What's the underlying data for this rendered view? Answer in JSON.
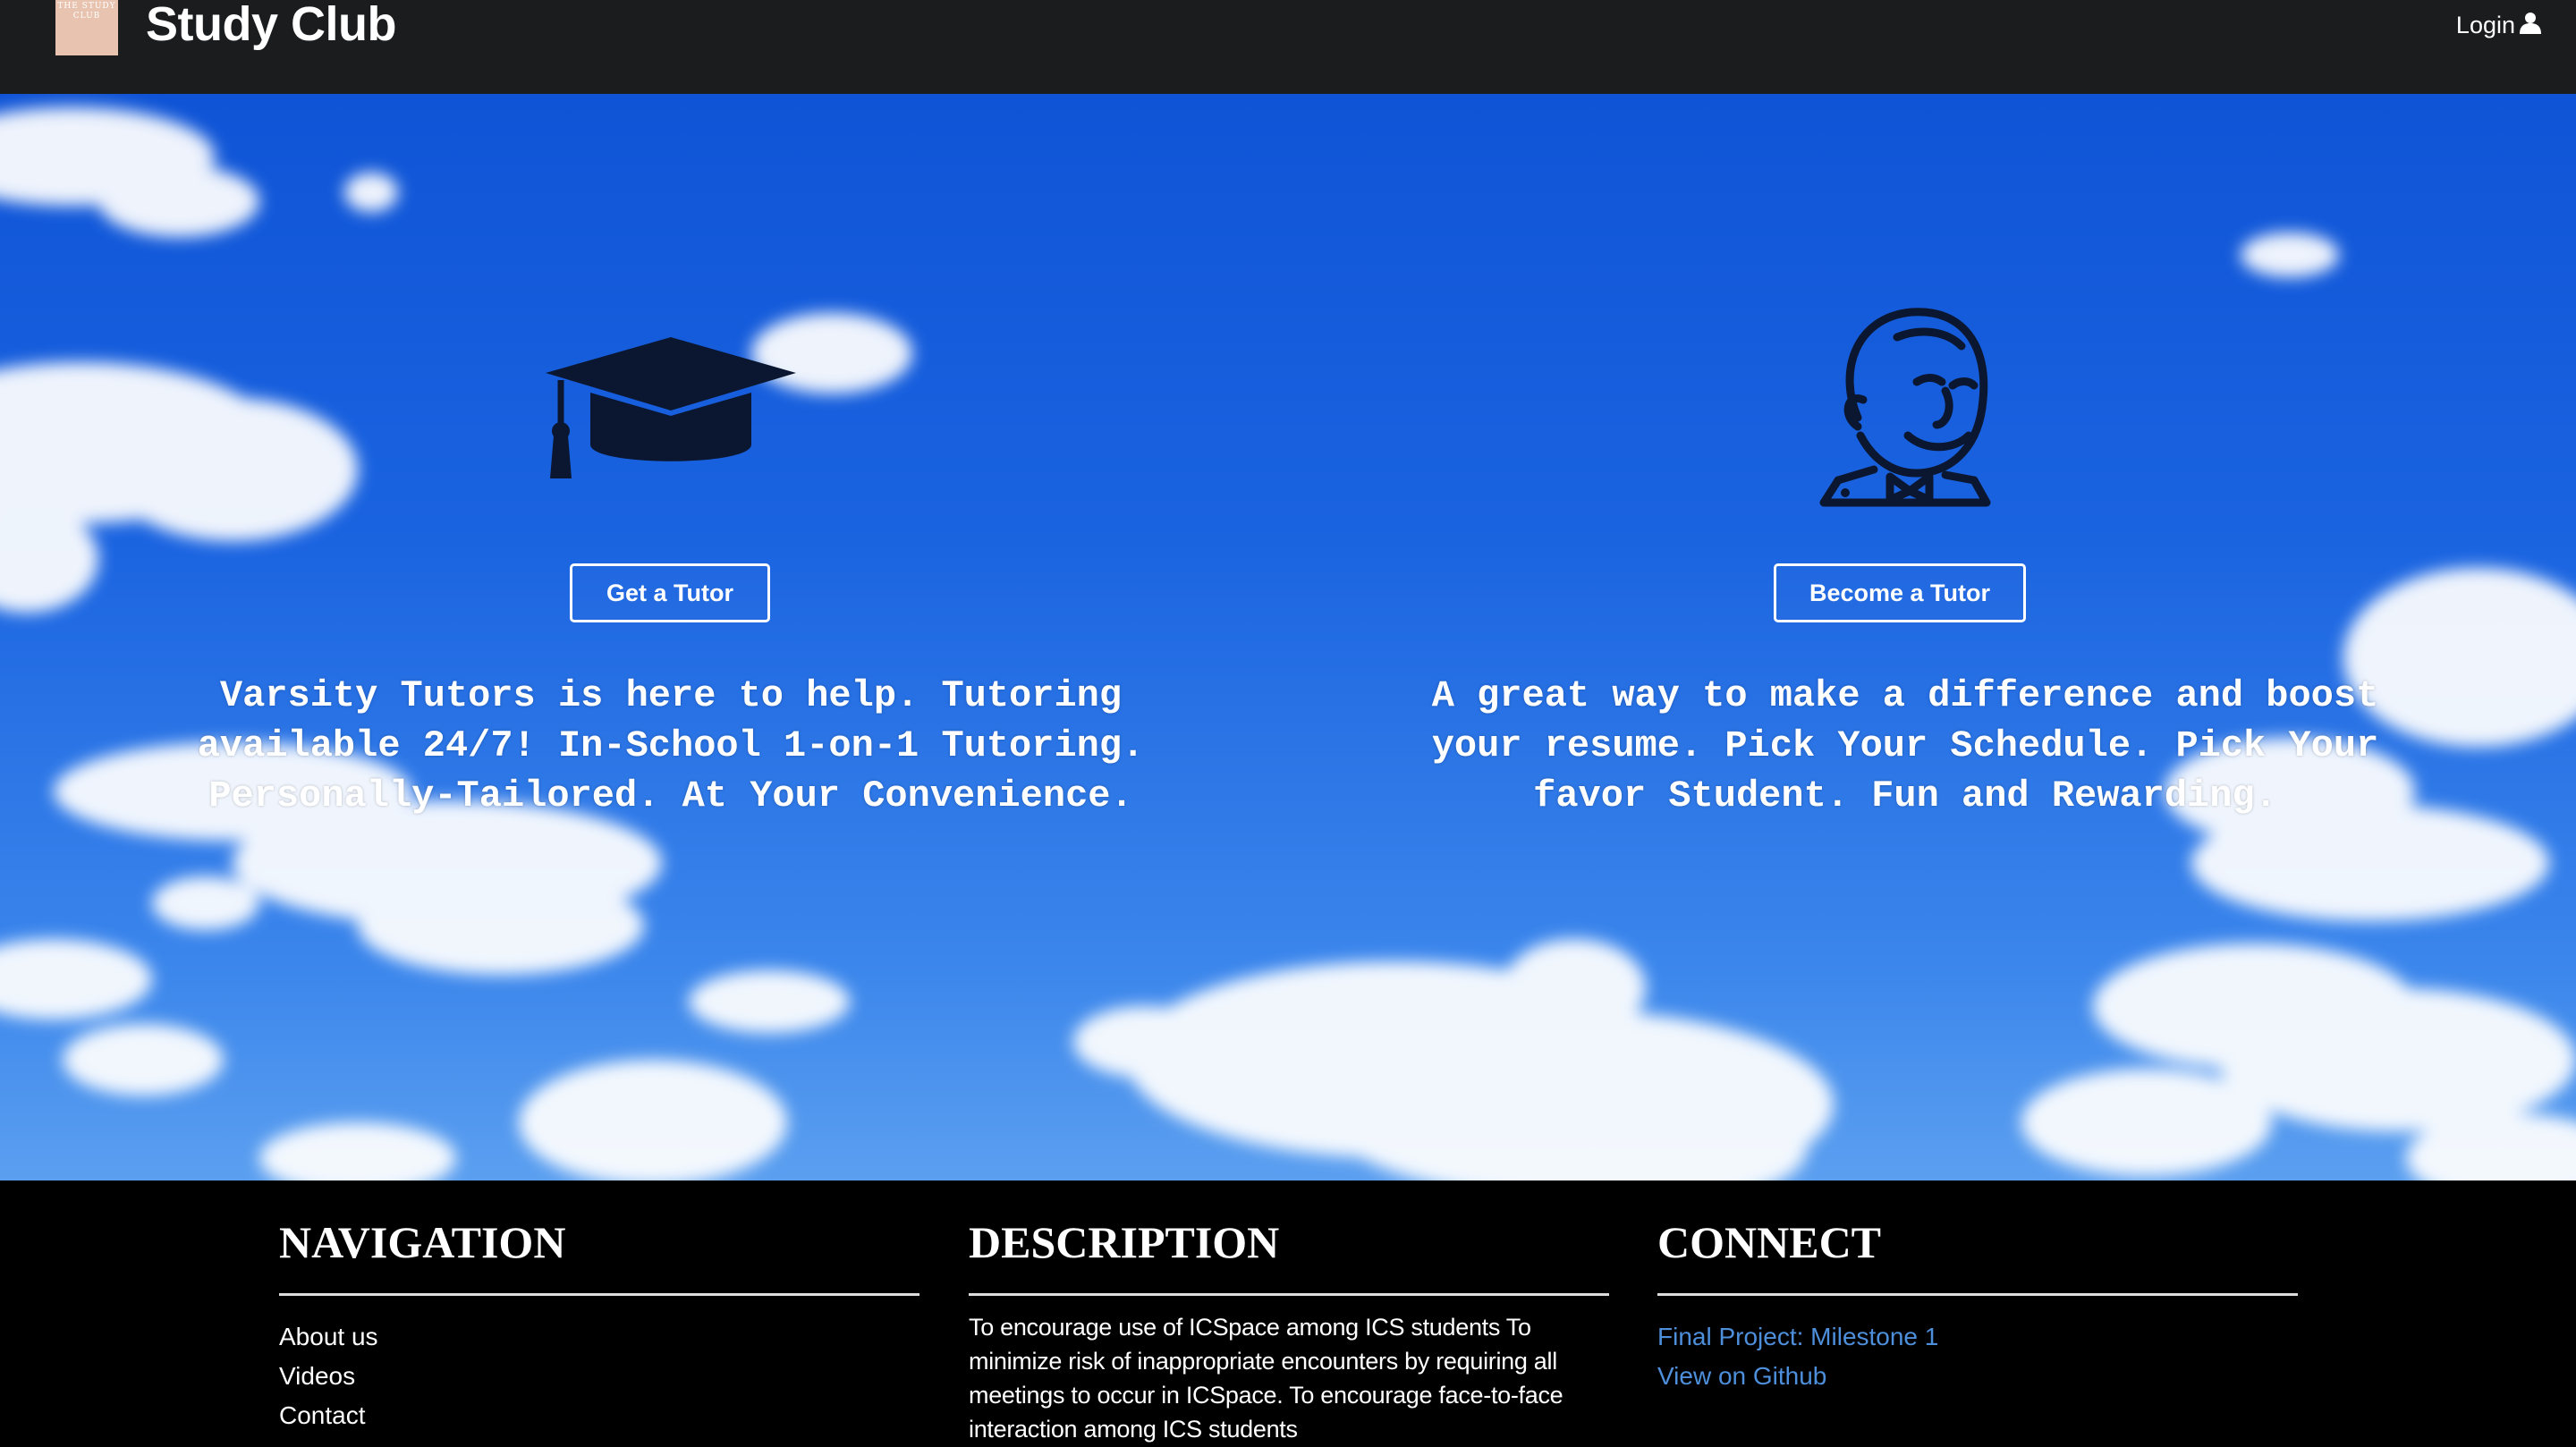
{
  "navbar": {
    "logo_text": "THE STUDY CLUB",
    "brand": "Study Club",
    "login_label": "Login",
    "login_icon": "user-icon"
  },
  "hero": {
    "left": {
      "icon": "graduation-cap-icon",
      "button": "Get a Tutor",
      "text": "Varsity Tutors is here to help. Tutoring available 24/7! In-School 1-on-1 Tutoring. Personally-Tailored. At Your Convenience."
    },
    "right": {
      "icon": "jenkins-butler-icon",
      "button": "Become a Tutor",
      "text": "A great way to make a difference and boost your resume. Pick Your Schedule. Pick Your favor Student. Fun and Rewarding."
    },
    "colors": {
      "sky_top": "#0f54d6",
      "sky_bottom": "#5b9ff0",
      "icon": "#0b1730"
    }
  },
  "footer": {
    "navigation": {
      "heading": "NAVIGATION",
      "links": [
        "About us",
        "Videos",
        "Contact"
      ]
    },
    "description": {
      "heading": "DESCRIPTION",
      "text": "To encourage use of ICSpace among ICS students To minimize risk of inappropriate encounters by requiring all meetings to occur in ICSpace. To encourage face-to-face interaction among ICS students"
    },
    "connect": {
      "heading": "CONNECT",
      "links": [
        "Final Project: Milestone 1",
        "View on Github"
      ],
      "link_color": "#4e8fdb"
    }
  }
}
